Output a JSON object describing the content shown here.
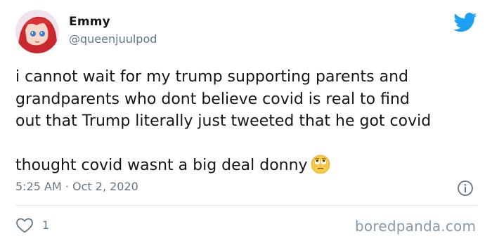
{
  "tweet": {
    "display_name": "Emmy",
    "handle": "@queenjuulpod",
    "text_lines": [
      "i cannot wait for my trump supporting parents and",
      "grandparents who dont believe covid is real to find",
      "out that Trump literally just tweeted that he got covid"
    ],
    "text_line_2": "thought covid wasnt a big deal donny",
    "emoji": "eye-roll-face-emoji",
    "timestamp": "5:25 AM · Oct 2, 2020",
    "like_count": "1"
  },
  "watermark": "boredpanda.com",
  "colors": {
    "twitter_blue": "#1da1f2",
    "text_primary": "#14171a",
    "text_secondary": "#657786",
    "divider": "#e1e8ed"
  },
  "icons": {
    "brand": "twitter-bird-icon",
    "info": "info-icon",
    "like": "heart-icon"
  }
}
